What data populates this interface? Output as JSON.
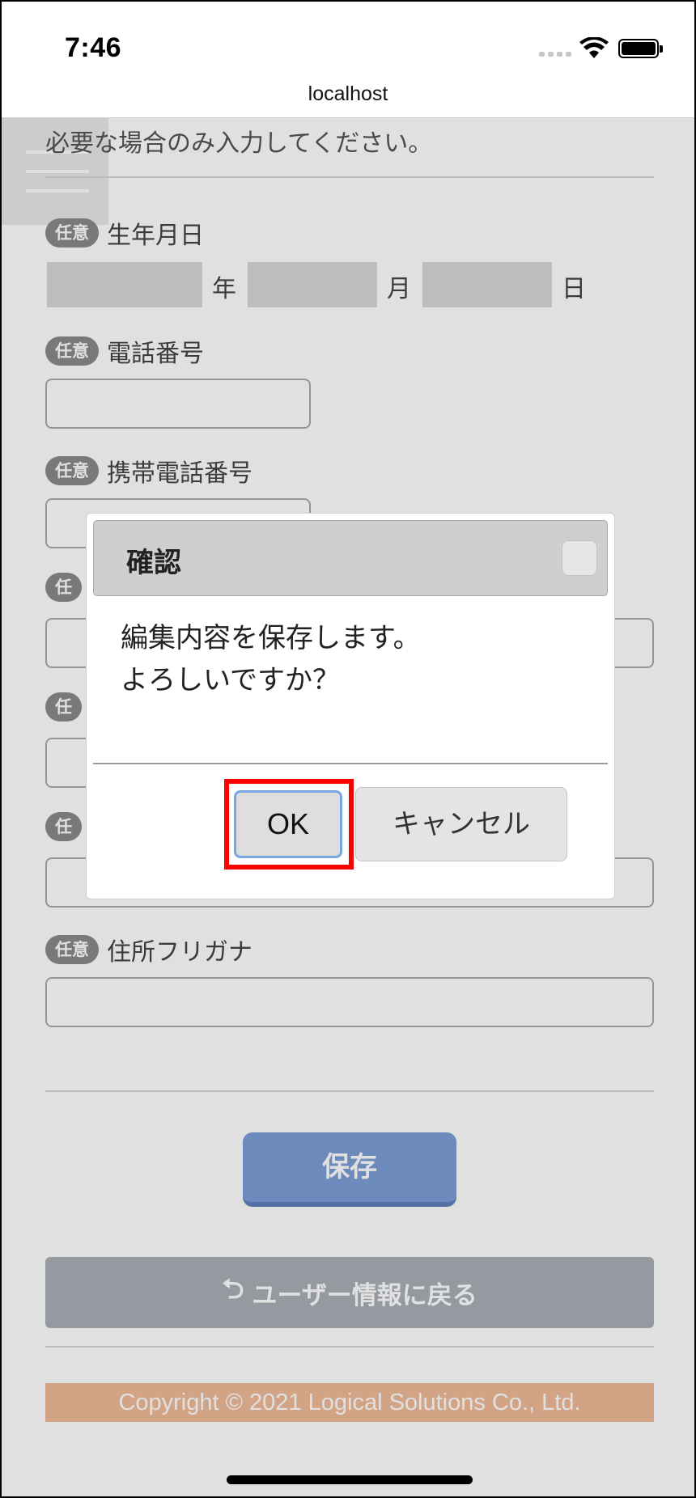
{
  "status_bar": {
    "time": "7:46"
  },
  "browser": {
    "url": "localhost"
  },
  "form": {
    "intro": "必要な場合のみ入力してください。",
    "birthdate": {
      "badge": "任意",
      "label": "生年月日",
      "year_unit": "年",
      "month_unit": "月",
      "day_unit": "日"
    },
    "phone": {
      "badge": "任意",
      "label": "電話番号",
      "value": ""
    },
    "mobile": {
      "badge": "任意",
      "label": "携帯電話番号",
      "value": ""
    },
    "hidden_field_1": {
      "badge": "任"
    },
    "hidden_field_2": {
      "badge": "任"
    },
    "hidden_field_3": {
      "badge": "任"
    },
    "address_kana": {
      "badge": "任意",
      "label": "住所フリガナ",
      "value": ""
    },
    "save_label": "保存",
    "back_label": "ユーザー情報に戻る",
    "back_icon": "return-arrow-icon",
    "footer": "Copyright © 2021 Logical Solutions Co., Ltd."
  },
  "dialog": {
    "title": "確認",
    "message_line1": "編集内容を保存します。",
    "message_line2": "よろしいですか？",
    "ok_label": "OK",
    "cancel_label": "キャンセル"
  },
  "colors": {
    "save_button": "#7b9fd6",
    "back_button": "#a9b0b6",
    "footer": "#f0bb98",
    "highlight": "#ff0000"
  }
}
